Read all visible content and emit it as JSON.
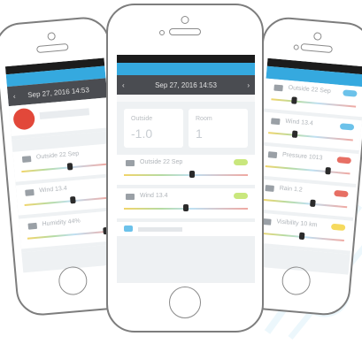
{
  "colors": {
    "accent": "#35a9df",
    "datebar": "#4a4c51",
    "status_green": "#c9e77d",
    "status_blue": "#6cc2ea",
    "status_red": "#e76f64",
    "status_yellow": "#f6da5e",
    "alert_red": "#e2483a"
  },
  "center": {
    "date_label": "Sep 27, 2016  14:53",
    "cards": [
      {
        "label": "Outside",
        "value": "-1.0"
      },
      {
        "label": "Room",
        "value": "1"
      }
    ],
    "rows": [
      {
        "label": "Outside  22 Sep",
        "status": "green",
        "level": 0.55
      },
      {
        "label": "Wind  13.4",
        "status": "green",
        "level": 0.5
      }
    ]
  },
  "left": {
    "date_label": "Sep 27, 2016  14:53",
    "rows": [
      {
        "label": "Outside  22 Sep",
        "level": 0.58
      },
      {
        "label": "Wind  13.4",
        "level": 0.58
      },
      {
        "label": "Humidity  44%",
        "level": 0.95
      }
    ]
  },
  "right": {
    "rows": [
      {
        "label": "Outside  22 Sep",
        "status": "blue",
        "level": 0.25
      },
      {
        "label": "Wind  13.4",
        "status": "blue",
        "level": 0.3
      },
      {
        "label": "Pressure  1013",
        "status": "red",
        "level": 0.75
      },
      {
        "label": "Rain  1.2",
        "status": "red",
        "level": 0.6
      },
      {
        "label": "Visibility  10 km",
        "status": "yellow",
        "level": 0.5
      }
    ]
  }
}
